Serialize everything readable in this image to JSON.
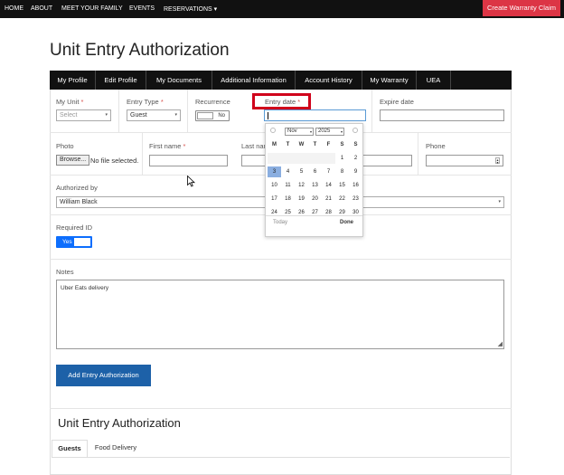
{
  "topnav": {
    "items": [
      "HOME",
      "ABOUT",
      "MEET YOUR FAMILY",
      "EVENTS",
      "RESERVATIONS ▾"
    ],
    "warranty_button": "Create Warranty Claim"
  },
  "page": {
    "title": "Unit Entry Authorization"
  },
  "tabs": [
    "My Profile",
    "Edit Profile",
    "My Documents",
    "Additional Information",
    "Account History",
    "My Warranty",
    "UEA"
  ],
  "form": {
    "my_unit": {
      "label": "My Unit",
      "required_mark": "*",
      "placeholder": "Select"
    },
    "entry_type": {
      "label": "Entry Type",
      "required_mark": "*",
      "value": "Guest"
    },
    "recurrence": {
      "label": "Recurrence",
      "toggle_text": "No"
    },
    "entry_date": {
      "label": "Entry date",
      "required_mark": "*",
      "value": ""
    },
    "expire_date": {
      "label": "Expire date",
      "value": ""
    },
    "photo": {
      "label": "Photo",
      "button": "Browse...",
      "status": "No file selected."
    },
    "first_name": {
      "label": "First name",
      "required_mark": "*",
      "value": ""
    },
    "last_name": {
      "label": "Last nam",
      "value": ""
    },
    "phone": {
      "label": "Phone",
      "value": ""
    },
    "authorized_by": {
      "label": "Authorized by",
      "value": "William Black"
    },
    "required_id": {
      "label": "Required ID",
      "toggle_text": "Yes"
    },
    "notes": {
      "label": "Notes",
      "value": "Uber Eats delivery"
    },
    "submit_button": "Add Entry Authorization"
  },
  "datepicker": {
    "month": "Nov",
    "year": "2025",
    "weekdays": [
      "M",
      "T",
      "W",
      "T",
      "F",
      "S",
      "S"
    ],
    "weeks": [
      [
        "27",
        "28",
        "29",
        "30",
        "31",
        "1",
        "2"
      ],
      [
        "3",
        "4",
        "5",
        "6",
        "7",
        "8",
        "9"
      ],
      [
        "10",
        "11",
        "12",
        "13",
        "14",
        "15",
        "16"
      ],
      [
        "17",
        "18",
        "19",
        "20",
        "21",
        "22",
        "23"
      ],
      [
        "24",
        "25",
        "26",
        "27",
        "28",
        "29",
        "30"
      ]
    ],
    "other_month_days": [
      "27",
      "28",
      "29",
      "30",
      "31"
    ],
    "today": "3",
    "today_button": "Today",
    "done_button": "Done"
  },
  "list_section": {
    "title": "Unit Entry Authorization",
    "tabs": [
      "Guests",
      "Food Delivery"
    ],
    "active_tab": "Guests"
  },
  "colors": {
    "nav_bg": "#111111",
    "warranty_button": "#dc3545",
    "primary": "#1d61a8",
    "toggle_on": "#0d6efd",
    "highlight": "#d0021b",
    "datepicker_today": "#8aaee0"
  }
}
